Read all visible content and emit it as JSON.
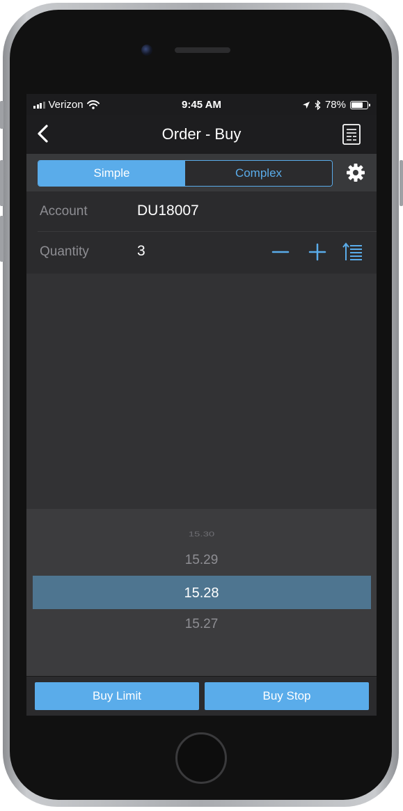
{
  "status_bar": {
    "carrier": "Verizon",
    "time": "9:45 AM",
    "battery": "78%",
    "battery_level": 0.78
  },
  "nav": {
    "title": "Order - Buy",
    "back_icon": "chevron-left-icon",
    "right_icon": "document-icon"
  },
  "order_type": {
    "options": [
      "Simple",
      "Complex"
    ],
    "selected": "Simple",
    "settings_icon": "gear-icon"
  },
  "form": {
    "account_label": "Account",
    "account_value": "DU18007",
    "quantity_label": "Quantity",
    "quantity_value": "3"
  },
  "price_picker": {
    "items": [
      "15.30",
      "15.29",
      "15.28",
      "15.27"
    ],
    "selected": "15.28"
  },
  "actions": {
    "buy_limit": "Buy Limit",
    "buy_stop": "Buy Stop"
  },
  "colors": {
    "accent": "#5aacea",
    "selection": "#4e7590",
    "background": "#2b2b2d"
  }
}
